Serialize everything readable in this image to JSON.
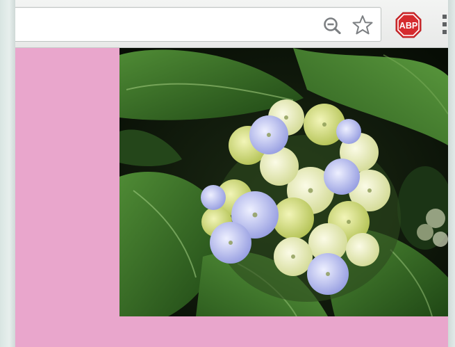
{
  "browser": {
    "address_bar": {
      "value": "",
      "placeholder": ""
    },
    "icons": {
      "zoom": "zoom-out-magnifier-icon",
      "bookmark": "bookmark-star-icon",
      "adblock": "adblock-plus-icon",
      "menu": "browser-menu-icon"
    },
    "adblock_label": "ABP"
  },
  "page": {
    "background_color": "#e9a6cc",
    "image": {
      "subject": "hydrangea-flower-photo"
    }
  },
  "colors": {
    "abp_red": "#d52b2e",
    "toolbar_icon_grey": "#7c7f82",
    "page_pink": "#e9a6cc"
  }
}
